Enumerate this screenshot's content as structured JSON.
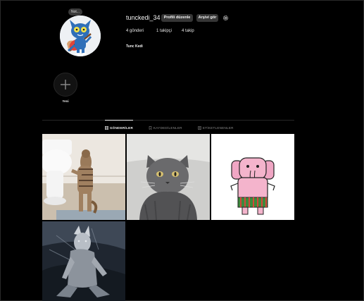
{
  "profile": {
    "note": "Not...",
    "username": "tunckedi_34",
    "edit_button": "Profili düzenle",
    "archive_button": "Arşivi gör",
    "stats": {
      "posts": "4 gönderi",
      "followers": "1 takipçi",
      "following": "4 takip"
    },
    "full_name": "Tunc Kedi"
  },
  "highlights": {
    "new_label": "Yeni"
  },
  "tabs": [
    {
      "label": "GÖNDERİLER",
      "active": true,
      "icon": "grid-icon"
    },
    {
      "label": "KAYDEDİLENLER",
      "active": false,
      "icon": "bookmark-icon"
    },
    {
      "label": "ETİKETLENENLER",
      "active": false,
      "icon": "tag-icon"
    }
  ],
  "colors": {
    "background": "#000000",
    "button": "#363636",
    "text": "#f5f5f5",
    "muted": "#8e8e8e"
  }
}
